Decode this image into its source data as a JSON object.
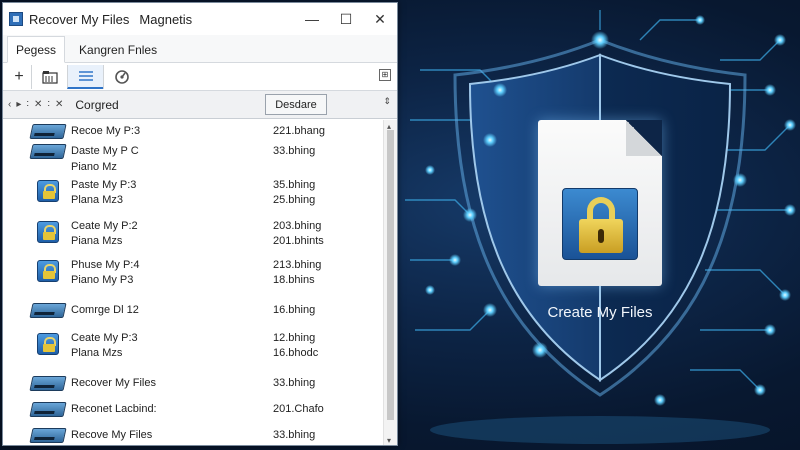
{
  "window": {
    "title": "Recover My Files",
    "subtitle": "Magnetis",
    "controls": {
      "minimize": "—",
      "maximize": "☐",
      "close": "✕"
    }
  },
  "tabs": [
    {
      "label": "Pegess",
      "active": true
    },
    {
      "label": "Kangren Fnles",
      "active": false
    }
  ],
  "toolbar": {
    "add": "+",
    "icons": [
      "folder-icon",
      "list-view-icon",
      "gauge-icon"
    ],
    "right": "⊞"
  },
  "address": {
    "nav": [
      "‹",
      "▸",
      "∶",
      "✕",
      "∶",
      "✕"
    ],
    "label": "Corgred",
    "sort_button": "Desdare",
    "sort_arrow": "⇕"
  },
  "rows": [
    {
      "icon": "drive",
      "name": "Recoe My P:3",
      "size": "221.bhang"
    },
    {
      "icon": "drive",
      "name": "Daste My P C",
      "size": "33.bhing"
    },
    {
      "icon": "none",
      "name": "Piano Mz",
      "size": ""
    },
    {
      "icon": "lock",
      "name": "Paste My P:3",
      "size": "35.bhing"
    },
    {
      "icon": "none",
      "name": "Plana Mz3",
      "size": "25.bhing"
    },
    {
      "icon": "lock",
      "name": "Ceate My P:2",
      "size": "203.bhing"
    },
    {
      "icon": "none",
      "name": "Piana Mzs",
      "size": "201.bhints"
    },
    {
      "icon": "lock",
      "name": "Phuse My P:4",
      "size": "213.bhing"
    },
    {
      "icon": "none",
      "name": "Piano My P3",
      "size": "18.bhins"
    },
    {
      "icon": "drive",
      "name": "Comrge Dl 12",
      "size": "16.bhing"
    },
    {
      "icon": "lock",
      "name": "Ceate My P:3",
      "size": "12.bhing"
    },
    {
      "icon": "none",
      "name": "Plana Mzs",
      "size": "16.bhodc"
    },
    {
      "icon": "drive",
      "name": "Recover My Files",
      "size": "33.bhing"
    },
    {
      "icon": "drive",
      "name": "Reconet Lacbind:",
      "size": "201.Chafo"
    },
    {
      "icon": "drive",
      "name": "Recove My Files",
      "size": "33.bhing"
    }
  ],
  "scrollbar": {
    "up": "▴",
    "down": "▾"
  },
  "hero": {
    "caption": "Create My Files",
    "colors": {
      "glow": "#5fd0ff",
      "shield_dark": "#0c2a52",
      "shield_light": "#1f5190",
      "lock_gold": "#e5c437"
    }
  }
}
